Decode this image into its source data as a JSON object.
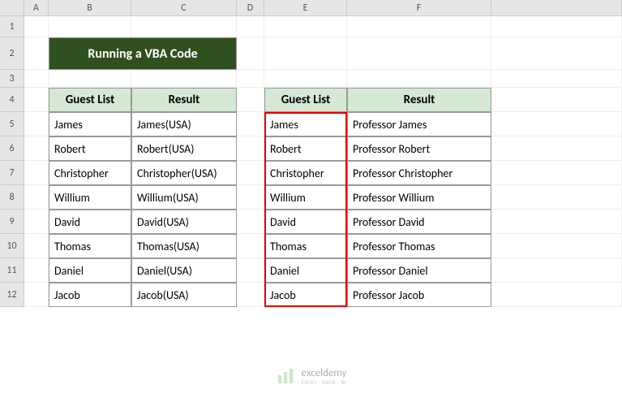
{
  "columns": [
    "A",
    "B",
    "C",
    "D",
    "E",
    "F"
  ],
  "rows": [
    "1",
    "2",
    "3",
    "4",
    "5",
    "6",
    "7",
    "8",
    "9",
    "10",
    "11",
    "12"
  ],
  "title": "Running a VBA Code",
  "table1": {
    "header1": "Guest List",
    "header2": "Result",
    "data": [
      {
        "g": "James",
        "r": "James(USA)"
      },
      {
        "g": "Robert",
        "r": "Robert(USA)"
      },
      {
        "g": "Christopher",
        "r": "Christopher(USA)"
      },
      {
        "g": "Willium",
        "r": "Willium(USA)"
      },
      {
        "g": "David",
        "r": "David(USA)"
      },
      {
        "g": "Thomas",
        "r": "Thomas(USA)"
      },
      {
        "g": "Daniel",
        "r": "Daniel(USA)"
      },
      {
        "g": "Jacob",
        "r": "Jacob(USA)"
      }
    ]
  },
  "table2": {
    "header1": "Guest List",
    "header2": "Result",
    "data": [
      {
        "g": "James",
        "r": "Professor James"
      },
      {
        "g": "Robert",
        "r": "Professor Robert"
      },
      {
        "g": "Christopher",
        "r": "Professor Christopher"
      },
      {
        "g": "Willium",
        "r": "Professor Willium"
      },
      {
        "g": "David",
        "r": "Professor David"
      },
      {
        "g": "Thomas",
        "r": "Professor Thomas"
      },
      {
        "g": "Daniel",
        "r": "Professor Daniel"
      },
      {
        "g": "Jacob",
        "r": "Professor Jacob"
      }
    ]
  },
  "watermark": {
    "name": "exceldemy",
    "sub": "EXCEL · DATA · BI"
  }
}
